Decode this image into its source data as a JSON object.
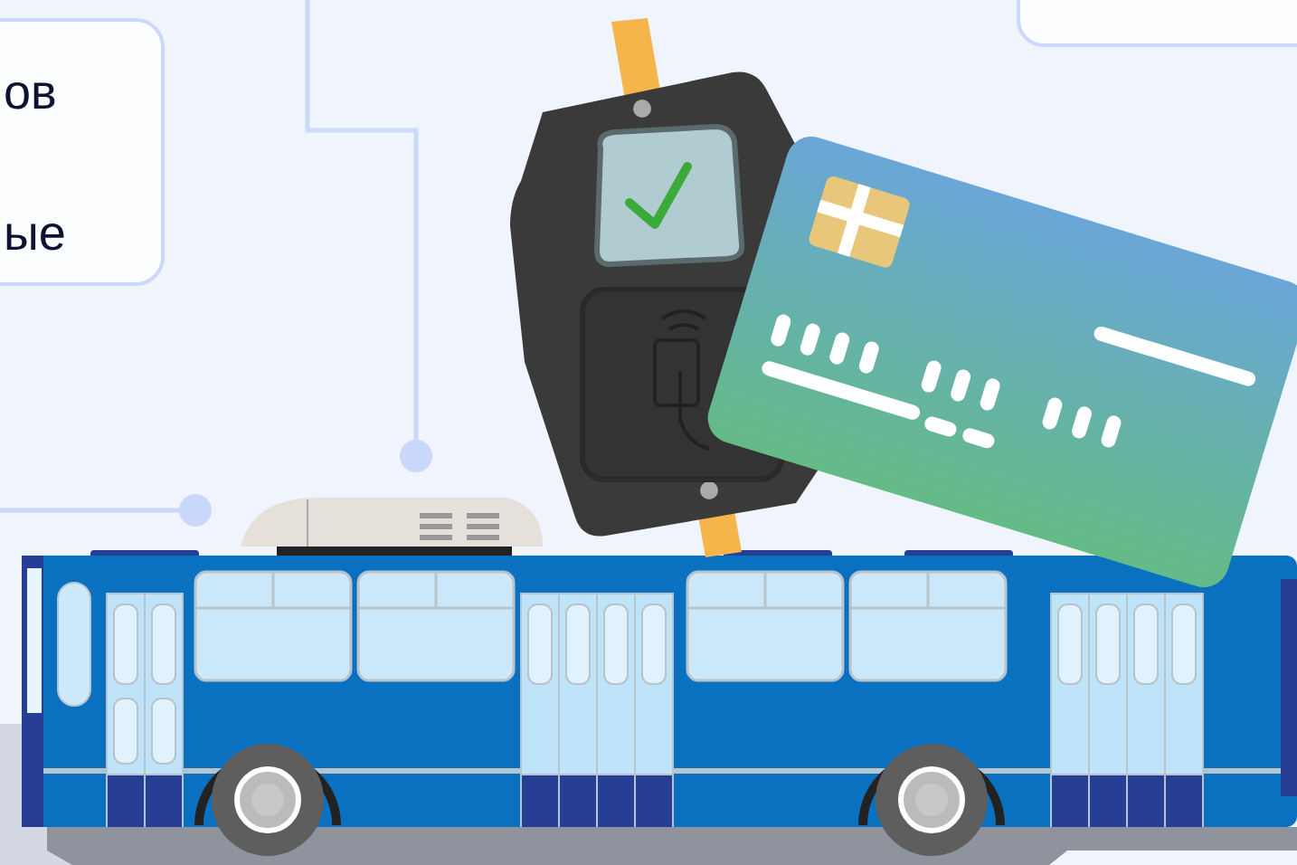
{
  "info_card": {
    "lines": [
      "ов",
      "ые"
    ]
  }
}
